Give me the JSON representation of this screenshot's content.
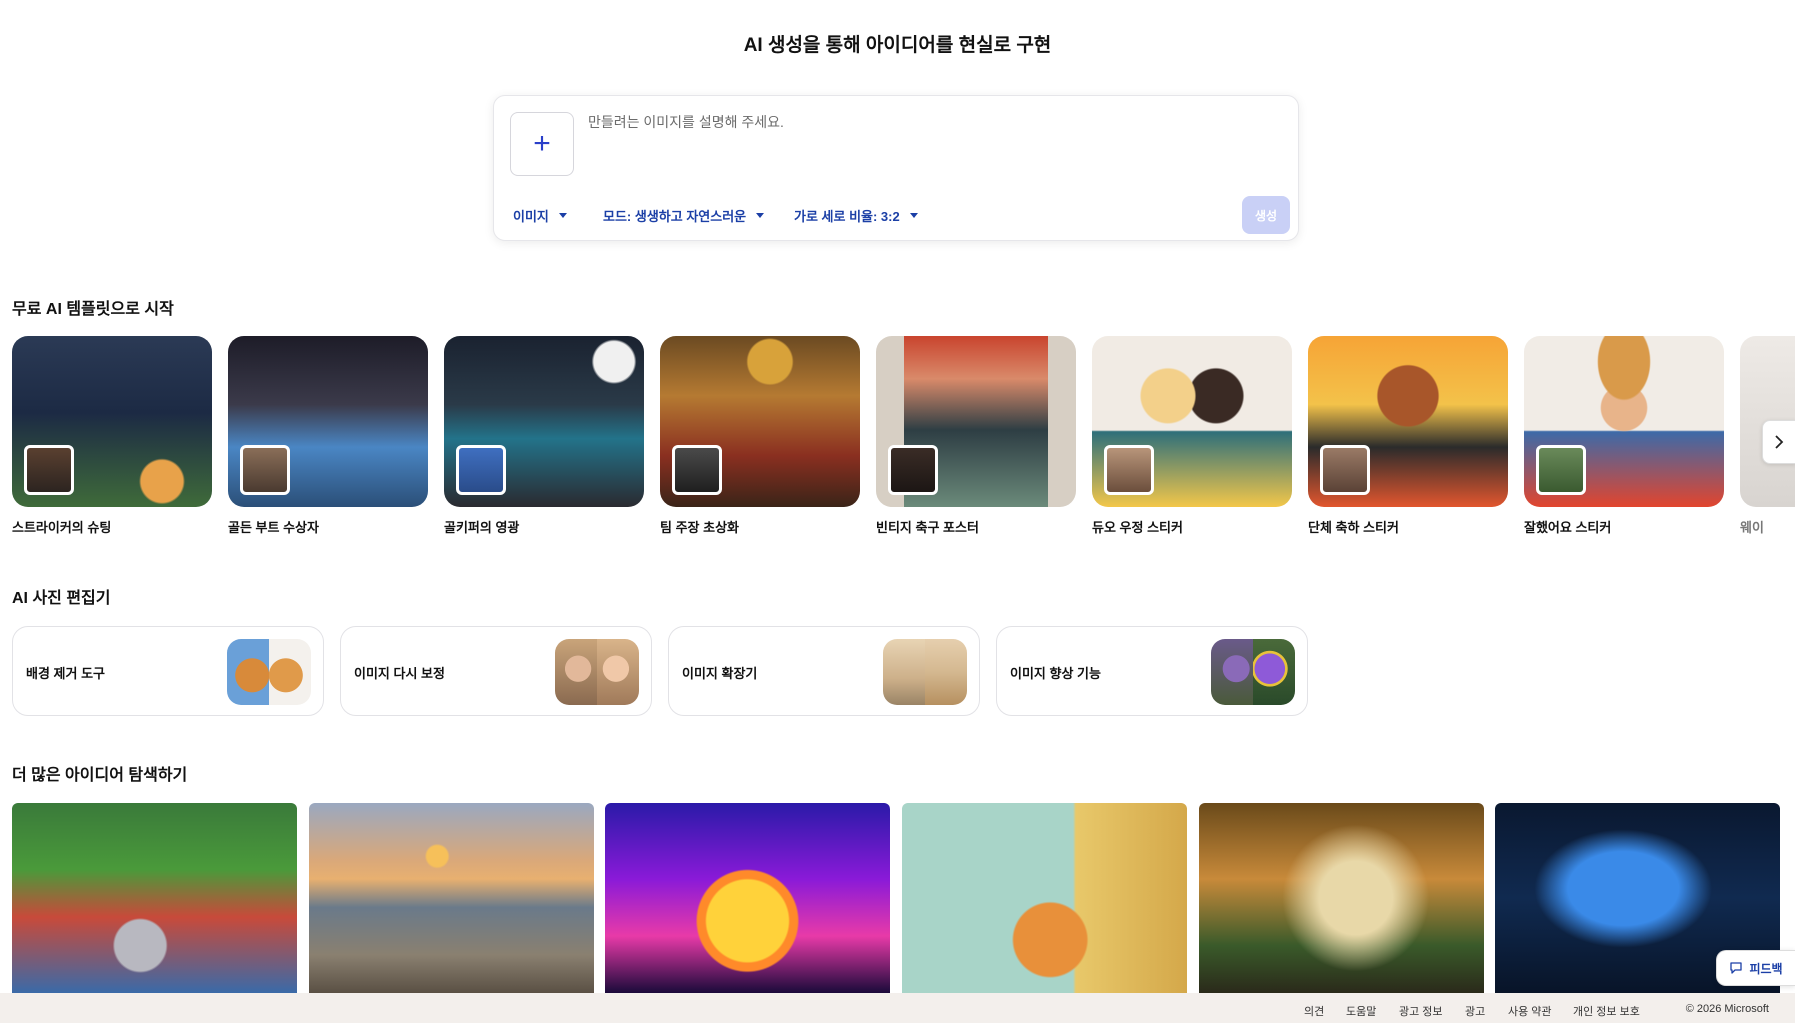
{
  "page": {
    "title": "AI 생성을 통해 아이디어를 현실로 구현"
  },
  "prompt": {
    "placeholder": "만들려는 이미지를 설명해 주세요.",
    "add_icon": "plus-icon",
    "image_option": "이미지",
    "mode_option": "모드: 생생하고 자연스러운",
    "ratio_option": "가로 세로 비율: 3:2",
    "generate_label": "생성"
  },
  "templates": {
    "title": "무료 AI 템플릿으로 시작",
    "items": [
      {
        "label": "스트라이커의 슈팅"
      },
      {
        "label": "골든 부트 수상자"
      },
      {
        "label": "골키퍼의 영광"
      },
      {
        "label": "팀 주장 초상화"
      },
      {
        "label": "빈티지 축구 포스터"
      },
      {
        "label": "듀오 우정 스티커"
      },
      {
        "label": "단체 축하 스티커"
      },
      {
        "label": "잘했어요 스티커"
      },
      {
        "label": "웨이"
      }
    ],
    "next_icon": "chevron-right-icon"
  },
  "editor": {
    "title": "AI 사진 편집기",
    "items": [
      {
        "label": "배경 제거 도구"
      },
      {
        "label": "이미지 다시 보정"
      },
      {
        "label": "이미지 확장기"
      },
      {
        "label": "이미지 향상 기능"
      }
    ]
  },
  "ideas": {
    "title": "더 많은 아이디어 탐색하기"
  },
  "feedback": {
    "label": "피드백",
    "icon": "chat-bubble-icon"
  },
  "footer": {
    "links": [
      "의견",
      "도움말",
      "광고 정보",
      "광고",
      "사용 약관",
      "개인 정보 보호"
    ],
    "copyright": "© 2026 Microsoft"
  }
}
